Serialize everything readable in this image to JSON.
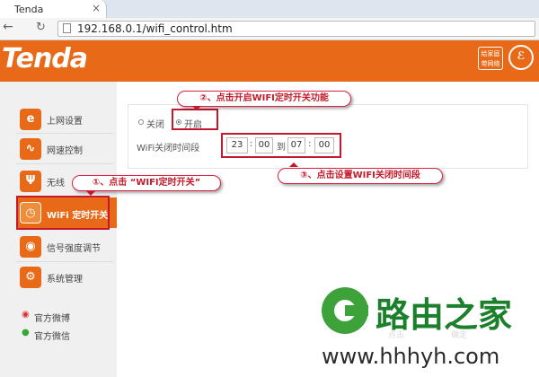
{
  "browser": {
    "tab_title": "Tenda",
    "tab_close": "×",
    "back": "←",
    "reload": "↻",
    "url": "192.168.0.1/wifi_control.htm"
  },
  "header": {
    "logo": "Tenda",
    "product_line1": "给家庭",
    "product_line2": "带网络",
    "emblem_mark": "ℰ"
  },
  "sidebar": {
    "items": [
      {
        "label": "上网设置",
        "icon": "e-globe-icon",
        "glyph": "e",
        "color": "#e86a18"
      },
      {
        "label": "网速控制",
        "icon": "speed-wave-icon",
        "glyph": "∿",
        "color": "#e86a18"
      },
      {
        "label": "无线",
        "icon": "wireless-icon",
        "glyph": "Ψ",
        "color": "#e86a18"
      },
      {
        "label": "WiFi 定时开关",
        "icon": "clock-icon",
        "glyph": "◷",
        "color": "#e86a18"
      },
      {
        "label": "信号强度调节",
        "icon": "signal-icon",
        "glyph": "◉",
        "color": "#e86a18"
      },
      {
        "label": "系统管理",
        "icon": "gear-icon",
        "glyph": "⚙",
        "color": "#e86a18"
      }
    ],
    "weibo": "官方微博",
    "weixin": "官方微信"
  },
  "wifi_schedule": {
    "option_off": "关闭",
    "option_on": "开启",
    "selected": "开启",
    "schedule_label": "WiFi关闭时间段",
    "start_hour": "23",
    "start_min": "00",
    "to": "到",
    "end_hour": "07",
    "end_min": "00",
    "colon": ":"
  },
  "annotations": {
    "step1": "①、点击 “WIFI定时开关”",
    "step2": "②、点击开启WIFI定时开关功能",
    "step3": "③、点击设置WIFI关闭时间段"
  },
  "watermark": {
    "title": "路由之家",
    "url": "www.hhhyh.com",
    "sub1": "点击",
    "sub2": "确定"
  },
  "colors": {
    "brand_orange": "#e86a18",
    "annotation_red": "#c4182c",
    "watermark_green": "#1c7f2c"
  }
}
